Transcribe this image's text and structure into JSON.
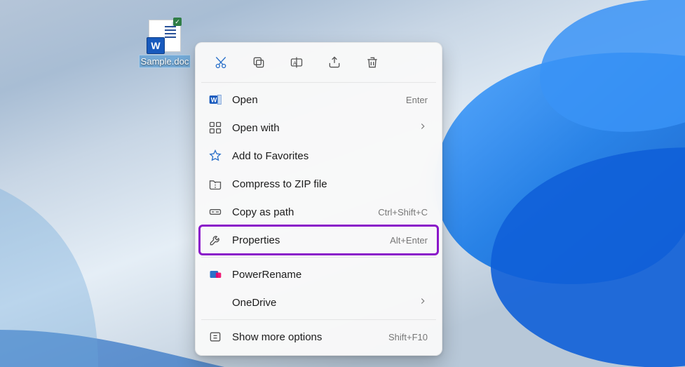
{
  "desktop": {
    "file_label": "Sample.doc"
  },
  "context_menu": {
    "actions": {
      "cut": "cut",
      "copy": "copy",
      "rename": "rename",
      "share": "share",
      "delete": "delete"
    },
    "items": {
      "open": {
        "label": "Open",
        "hint": "Enter"
      },
      "open_with": {
        "label": "Open with"
      },
      "favorites": {
        "label": "Add to Favorites"
      },
      "compress": {
        "label": "Compress to ZIP file"
      },
      "copy_path": {
        "label": "Copy as path",
        "hint": "Ctrl+Shift+C"
      },
      "properties": {
        "label": "Properties",
        "hint": "Alt+Enter"
      },
      "powerrename": {
        "label": "PowerRename"
      },
      "onedrive": {
        "label": "OneDrive"
      },
      "more": {
        "label": "Show more options",
        "hint": "Shift+F10"
      }
    }
  }
}
